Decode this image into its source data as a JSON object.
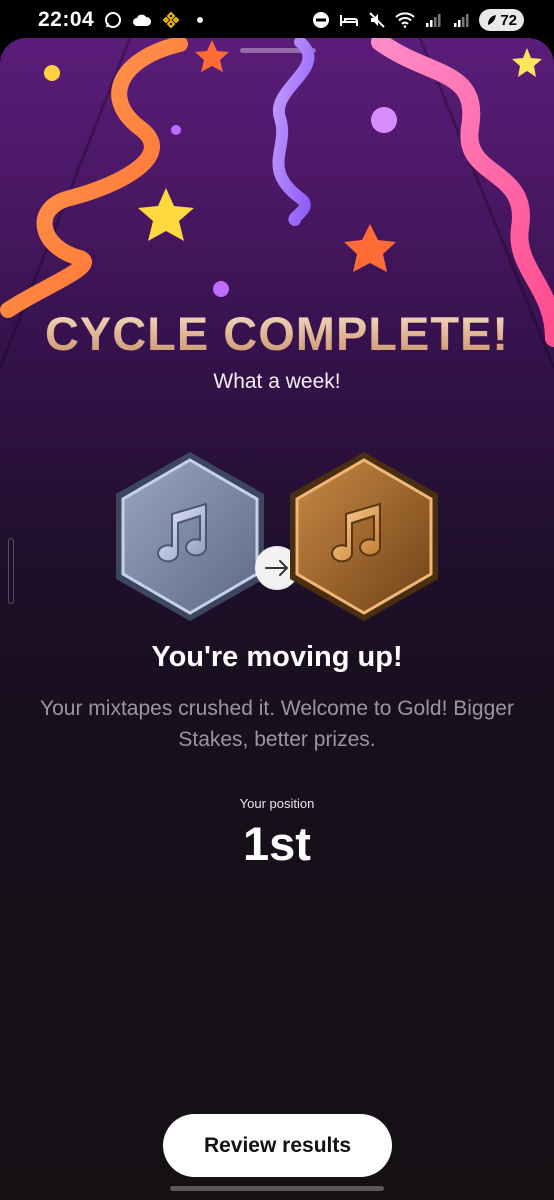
{
  "status_bar": {
    "time": "22:04",
    "battery": "72",
    "left_icons": [
      "whatsapp-icon",
      "cloud-icon",
      "binance-icon",
      "dot-icon"
    ],
    "right_icons": [
      "dnd-icon",
      "sleep-icon",
      "mute-icon",
      "wifi-icon",
      "signal-icon",
      "signal-icon"
    ]
  },
  "screen": {
    "title": "CYCLE COMPLETE!",
    "subtitle": "What a week!",
    "from_badge": "silver-music-badge-icon",
    "to_badge": "gold-music-badge-icon",
    "arrow": "arrow-right-icon",
    "headline": "You're moving up!",
    "description": "Your mixtapes crushed it. Welcome to Gold! Bigger Stakes, better prizes.",
    "position_label": "Your position",
    "position_value": "1st",
    "cta_label": "Review results"
  },
  "colors": {
    "bg_top": "#5a1d7a",
    "bg_bottom": "#141014",
    "title_gold": "#e2b796",
    "silver": "#8f9ab3",
    "gold": "#b77a3a",
    "button": "#ffffff"
  }
}
